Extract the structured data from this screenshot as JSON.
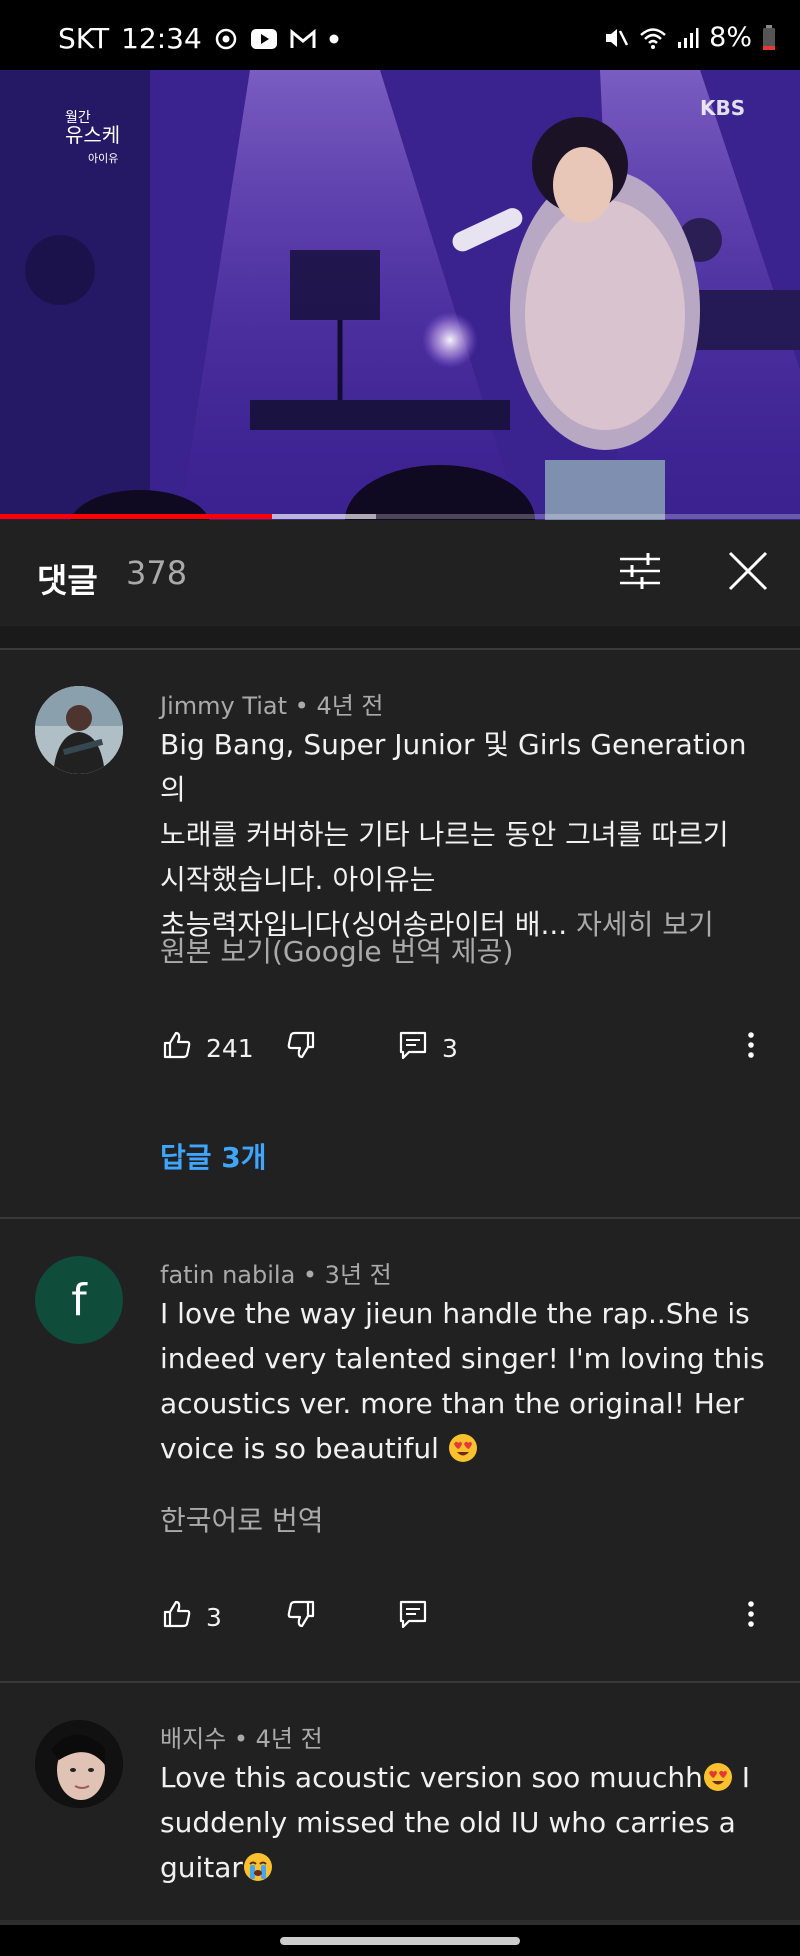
{
  "status_bar": {
    "carrier": "SKT",
    "time": "12:34",
    "battery": "8%",
    "icons": [
      "smartthings-icon",
      "youtube-icon",
      "gmail-icon",
      "dot-icon",
      "mute-icon",
      "wifi-icon",
      "signal-icon",
      "battery-icon"
    ]
  },
  "video": {
    "progress_played": 0.34,
    "progress_buffered": 0.47,
    "overlay_logo_text": "KBS"
  },
  "comments_header": {
    "title": "댓글",
    "count": "378",
    "filter_icon": "sliders-icon",
    "close_icon": "close-icon"
  },
  "comments": [
    {
      "author": "Jimmy Tiat",
      "time": "4년 전",
      "meta": "Jimmy Tiat • 4년 전",
      "lines": [
        "Big Bang, Super Junior 및 Girls Generation의",
        "노래를 커버하는 기타 나르는 동안 그녀를 따르기",
        "시작했습니다. 아이유는",
        "초능력자입니다(싱어송라이터 배..."
      ],
      "more_label": "자세히 보기",
      "translate_label": "원본 보기(Google 번역 제공)",
      "likes": "241",
      "reply_count": "3",
      "replies_link": "답글 3개"
    },
    {
      "author": "fatin nabila",
      "time": "3년 전",
      "meta": "fatin nabila • 3년 전",
      "avatar_letter": "f",
      "avatar_color": "#0f4c3a",
      "lines": [
        "I love the way jieun handle the rap..She is",
        "indeed very talented singer! I'm loving this",
        "acoustics ver. more than the original! Her",
        "voice is so beautiful"
      ],
      "translate_label": "한국어로 번역",
      "likes": "3"
    },
    {
      "author": "배지수",
      "time": "4년 전",
      "meta": "배지수 • 4년 전",
      "lines": [
        "Love this acoustic version soo muuchh",
        "suddenly missed the old IU who carries a",
        "guitar"
      ]
    }
  ],
  "colors": {
    "background": "#212121",
    "link_blue": "#3ea6ff",
    "secondary_text": "#aaaaaa",
    "progress_red": "#ff0000"
  }
}
